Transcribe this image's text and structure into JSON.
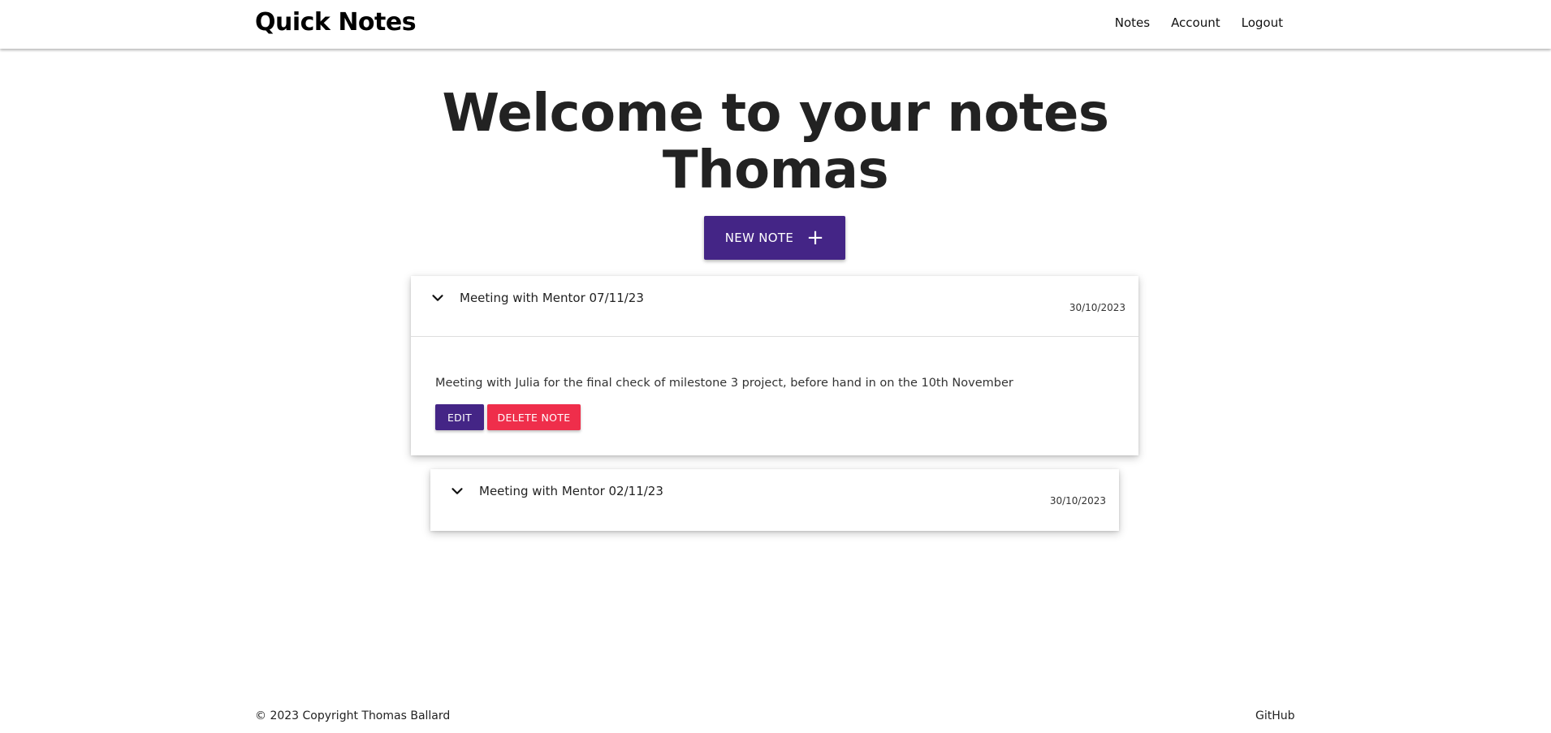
{
  "navbar": {
    "brand": "Quick Notes",
    "links": [
      {
        "label": "Notes"
      },
      {
        "label": "Account"
      },
      {
        "label": "Logout"
      }
    ]
  },
  "main": {
    "welcome_line1": "Welcome to your notes",
    "welcome_line2": "Thomas",
    "new_note_label": "NEW NOTE",
    "new_note_icon": "plus-icon"
  },
  "notes": [
    {
      "title": "Meeting with Mentor 07/11/23",
      "date": "30/10/2023",
      "expanded": true,
      "body": "Meeting with Julia for the final check of milestone 3 project, before hand in on the 10th November",
      "edit_label": "EDIT",
      "delete_label": "DELETE NOTE"
    },
    {
      "title": "Meeting with Mentor 02/11/23",
      "date": "30/10/2023",
      "expanded": false
    }
  ],
  "footer": {
    "copyright": "© 2023 Copyright Thomas Ballard",
    "github": "GitHub"
  },
  "colors": {
    "primary": "#442586",
    "danger": "#ef2e4b"
  }
}
